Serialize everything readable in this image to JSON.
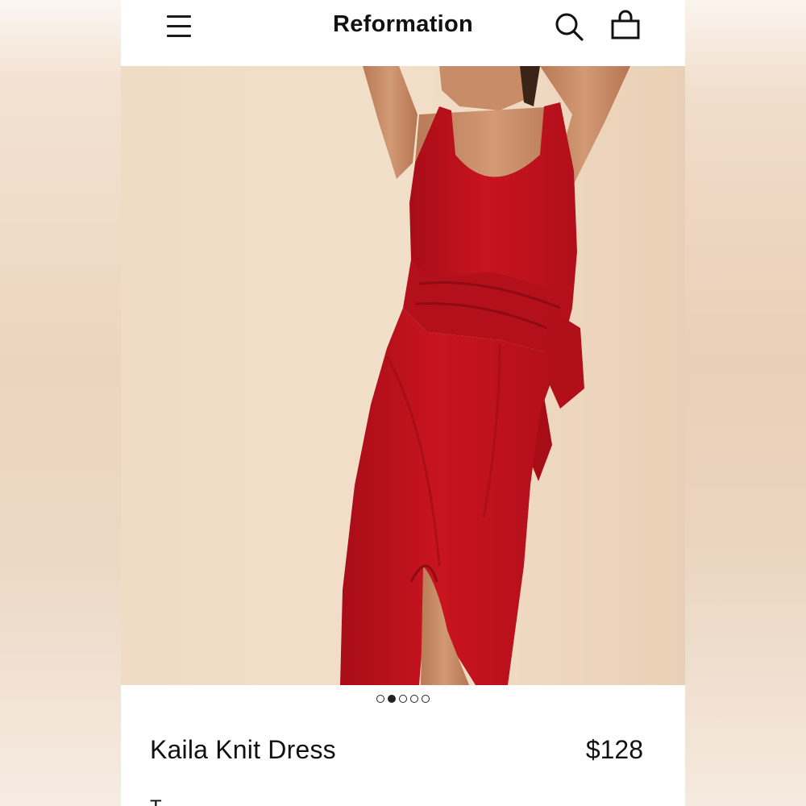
{
  "header": {
    "brand": "Reformation",
    "menu_icon": "hamburger-menu-icon",
    "search_icon": "search-icon",
    "bag_icon": "shopping-bag-icon"
  },
  "hero": {
    "description": "",
    "dress_color": "#c0121f",
    "background_color": "#efd9c0"
  },
  "carousel": {
    "total": 5,
    "active_index": 1
  },
  "product": {
    "name": "Kaila Knit Dress",
    "price": "$128",
    "partial_text": "T"
  },
  "colors": {
    "accent": "#111111",
    "dress_red": "#c0121f"
  }
}
